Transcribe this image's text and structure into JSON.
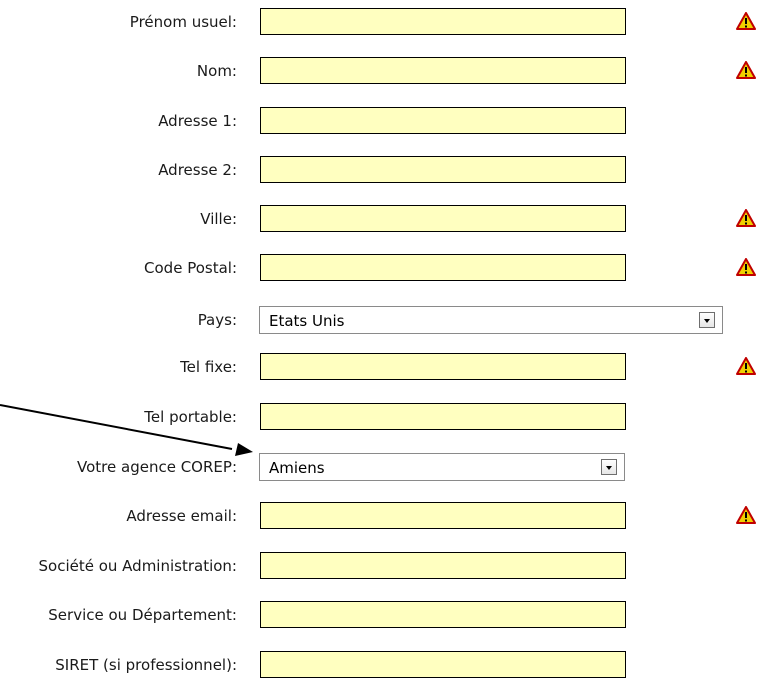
{
  "form": {
    "rows": [
      {
        "label": "Prénom usuel:",
        "required": true
      },
      {
        "label": "Nom:",
        "required": true
      },
      {
        "label": "Adresse 1:",
        "required": false
      },
      {
        "label": "Adresse 2:",
        "required": false
      },
      {
        "label": "Ville:",
        "required": true
      },
      {
        "label": "Code Postal:",
        "required": true
      },
      {
        "label": "Pays:",
        "select_value": "Etats Unis"
      },
      {
        "label": "Tel fixe:",
        "required": true
      },
      {
        "label": "Tel portable:",
        "required": false
      },
      {
        "label": "Votre agence COREP:",
        "select_value": "Amiens"
      },
      {
        "label": "Adresse email:",
        "required": true
      },
      {
        "label": "Société ou Administration:",
        "required": false
      },
      {
        "label": "Service ou Département:",
        "required": false
      },
      {
        "label": "SIRET (si professionnel):",
        "required": false
      }
    ]
  },
  "colors": {
    "field_background": "#ffffc0",
    "warning_fill": "#f0d000",
    "warning_border": "#c00000"
  },
  "icons": {
    "required": "warning-icon",
    "dropdown": "chevron-down-icon",
    "annotation": "annotation-arrow"
  }
}
